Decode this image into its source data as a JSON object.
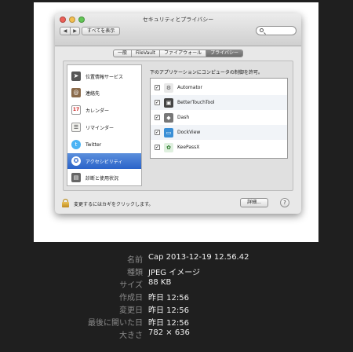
{
  "window": {
    "title": "セキュリティとプライバシー",
    "nav_back": "◀",
    "nav_forward": "▶",
    "show_all": "すべてを表示",
    "search_placeholder": ""
  },
  "tabs": [
    {
      "label": "一般"
    },
    {
      "label": "FileVault"
    },
    {
      "label": "ファイアウォール"
    },
    {
      "label": "プライバシー",
      "active": true
    }
  ],
  "sidebar": {
    "items": [
      {
        "label": "位置情報サービス",
        "icon": "location-arrow-icon"
      },
      {
        "label": "連絡先",
        "icon": "contacts-book-icon"
      },
      {
        "label": "カレンダー",
        "icon": "calendar-icon"
      },
      {
        "label": "リマインダー",
        "icon": "reminders-list-icon"
      },
      {
        "label": "Twitter",
        "icon": "twitter-bird-icon"
      },
      {
        "label": "アクセシビリティ",
        "icon": "accessibility-icon",
        "selected": true
      },
      {
        "label": "診断と使用状況",
        "icon": "diagnostics-icon"
      }
    ]
  },
  "pane": {
    "label": "下のアプリケーションにコンピュータの制御を許可。",
    "apps": [
      {
        "name": "Automator",
        "checked": true,
        "icon": "automator-robot-icon"
      },
      {
        "name": "BetterTouchTool",
        "checked": true,
        "icon": "bettertouchtool-icon"
      },
      {
        "name": "Dash",
        "checked": true,
        "icon": "dash-icon"
      },
      {
        "name": "DockView",
        "checked": true,
        "icon": "dockview-icon"
      },
      {
        "name": "KeePassX",
        "checked": true,
        "icon": "keepassx-icon"
      }
    ]
  },
  "bottom": {
    "lock_text": "変更するにはカギをクリックします。",
    "details": "詳細...",
    "help": "?"
  },
  "file_info": [
    {
      "label": "名前",
      "value": "Cap 2013-12-19 12.56.42"
    },
    {
      "label": "種類",
      "value": "JPEG イメージ"
    },
    {
      "label": "サイズ",
      "value": "88 KB"
    },
    {
      "label": "作成日",
      "value": "昨日 12:56"
    },
    {
      "label": "変更日",
      "value": "昨日 12:56"
    },
    {
      "label": "最後に開いた日",
      "value": "昨日 12:56"
    },
    {
      "label": "大きさ",
      "value": "782 × 636"
    }
  ],
  "colors": {
    "background": "#1f1f1f",
    "selection": "#2a63c9",
    "info_label": "#8a8a8a",
    "info_value": "#f0f0f0"
  }
}
